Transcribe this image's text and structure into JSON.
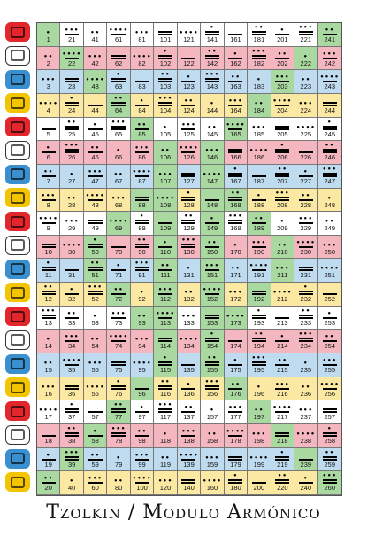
{
  "title": "Tzolkin / Modulo Armónico",
  "colors": {
    "white": "#ffffff",
    "green": "#a9d9a0",
    "red": "#f4b7bf",
    "blue": "#bfdbef",
    "yellow": "#fbe9a3"
  },
  "day_signs": [
    {
      "name": "imix",
      "color": "#e2262c"
    },
    {
      "name": "ik",
      "color": "#ffffff"
    },
    {
      "name": "akbal",
      "color": "#3a8fcf"
    },
    {
      "name": "kan",
      "color": "#f2c500"
    },
    {
      "name": "chicchan",
      "color": "#e2262c"
    },
    {
      "name": "cimi",
      "color": "#ffffff"
    },
    {
      "name": "manik",
      "color": "#3a8fcf"
    },
    {
      "name": "lamat",
      "color": "#f2c500"
    },
    {
      "name": "muluc",
      "color": "#e2262c"
    },
    {
      "name": "oc",
      "color": "#ffffff"
    },
    {
      "name": "chuen",
      "color": "#3a8fcf"
    },
    {
      "name": "eb",
      "color": "#f2c500"
    },
    {
      "name": "ben",
      "color": "#e2262c"
    },
    {
      "name": "ix",
      "color": "#ffffff"
    },
    {
      "name": "men",
      "color": "#3a8fcf"
    },
    {
      "name": "cib",
      "color": "#f2c500"
    },
    {
      "name": "caban",
      "color": "#e2262c"
    },
    {
      "name": "etznab",
      "color": "#ffffff"
    },
    {
      "name": "cauac",
      "color": "#3a8fcf"
    },
    {
      "name": "ahau",
      "color": "#f2c500"
    }
  ],
  "green_kin": [
    1,
    20,
    22,
    39,
    43,
    50,
    51,
    58,
    64,
    69,
    72,
    77,
    85,
    88,
    93,
    96,
    106,
    107,
    108,
    109,
    110,
    111,
    112,
    113,
    114,
    115,
    146,
    147,
    148,
    149,
    150,
    151,
    152,
    153,
    154,
    155,
    165,
    168,
    173,
    176,
    184,
    189,
    192,
    197,
    203,
    210,
    211,
    218,
    222,
    239,
    241,
    260
  ]
}
